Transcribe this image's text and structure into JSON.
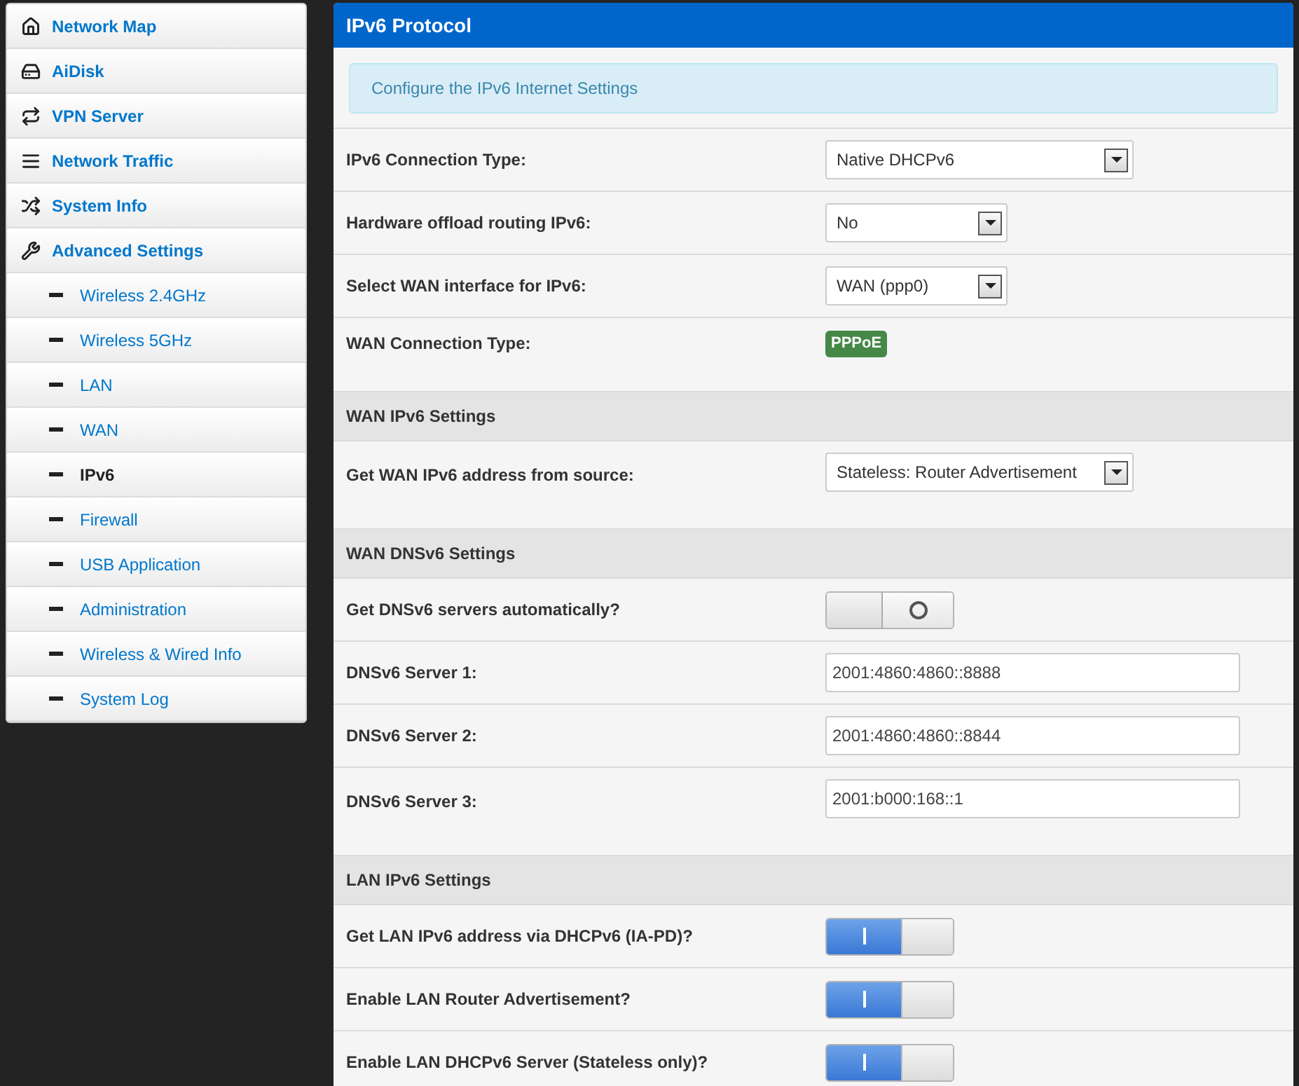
{
  "sidebar": {
    "items": [
      {
        "label": "Network Map",
        "selected": false
      },
      {
        "label": "AiDisk",
        "selected": false
      },
      {
        "label": "VPN Server",
        "selected": false
      },
      {
        "label": "Network Traffic",
        "selected": false
      },
      {
        "label": "System Info",
        "selected": false
      },
      {
        "label": "Advanced Settings",
        "selected": false,
        "children": [
          {
            "label": "Wireless 2.4GHz",
            "selected": false
          },
          {
            "label": "Wireless 5GHz",
            "selected": false
          },
          {
            "label": "LAN",
            "selected": false
          },
          {
            "label": "WAN",
            "selected": false
          },
          {
            "label": "IPv6",
            "selected": true
          },
          {
            "label": "Firewall",
            "selected": false
          },
          {
            "label": "USB Application",
            "selected": false
          },
          {
            "label": "Administration",
            "selected": false
          },
          {
            "label": "Wireless & Wired Info",
            "selected": false
          },
          {
            "label": "System Log",
            "selected": false
          }
        ]
      }
    ]
  },
  "panel": {
    "title": "IPv6 Protocol",
    "info": "Configure the IPv6 Internet Settings",
    "rows": [
      {
        "kind": "select",
        "label": "IPv6 Connection Type:",
        "value": "Native DHCPv6"
      },
      {
        "kind": "select",
        "label": "Hardware offload routing IPv6:",
        "value": "No"
      },
      {
        "kind": "select",
        "label": "Select WAN interface for IPv6:",
        "value": "WAN (ppp0)"
      },
      {
        "kind": "badge",
        "label": "WAN Connection Type:",
        "value": "PPPoE"
      },
      {
        "kind": "section",
        "label": "WAN IPv6 Settings"
      },
      {
        "kind": "select",
        "label": "Get WAN IPv6 address from source:",
        "value": "Stateless: Router Advertisement"
      },
      {
        "kind": "section",
        "label": "WAN DNSv6 Settings"
      },
      {
        "kind": "toggle",
        "label": "Get DNSv6 servers automatically?",
        "on": false
      },
      {
        "kind": "input",
        "label": "DNSv6 Server 1:",
        "value": "2001:4860:4860::8888"
      },
      {
        "kind": "input",
        "label": "DNSv6 Server 2:",
        "value": "2001:4860:4860::8844"
      },
      {
        "kind": "input",
        "label": "DNSv6 Server 3:",
        "value": "2001:b000:168::1"
      },
      {
        "kind": "section",
        "label": "LAN IPv6 Settings"
      },
      {
        "kind": "toggle",
        "label": "Get LAN IPv6 address via DHCPv6 (IA-PD)?",
        "on": true
      },
      {
        "kind": "toggle",
        "label": "Enable LAN Router Advertisement?",
        "on": true
      },
      {
        "kind": "toggle",
        "label": "Enable LAN DHCPv6 Server (Stateless only)?",
        "on": true
      }
    ]
  }
}
